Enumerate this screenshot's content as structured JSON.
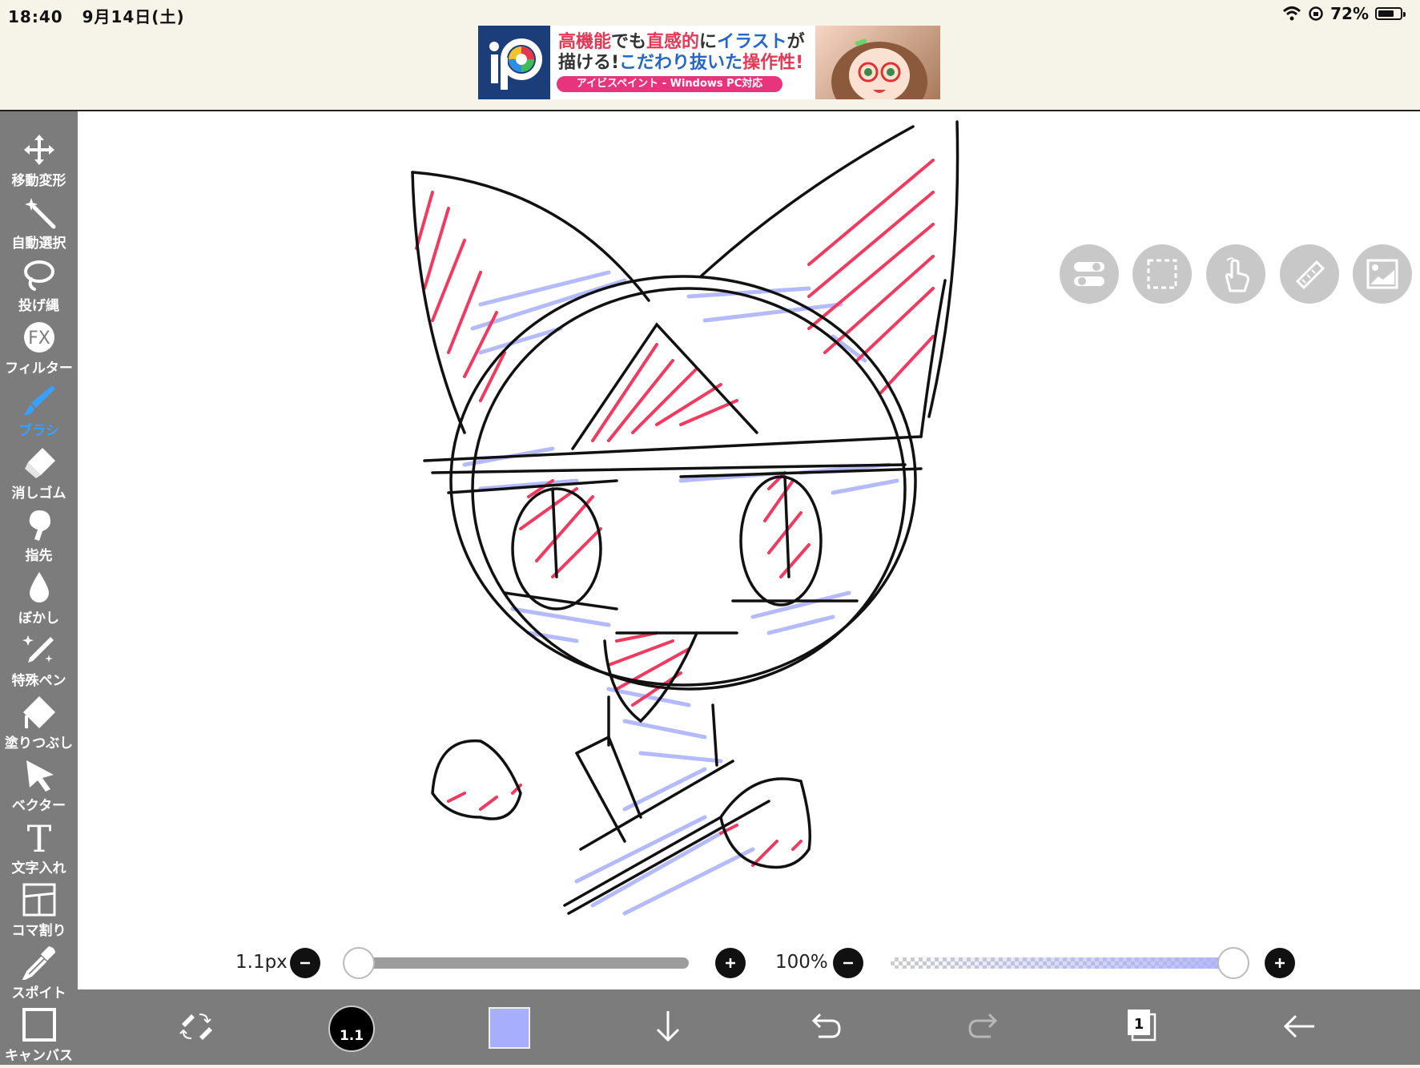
{
  "status": {
    "time": "18:40",
    "date": "9月14日(土)",
    "battery": "72%",
    "battery_level": 0.72
  },
  "ad": {
    "line1": {
      "a": "高機能",
      "b": "でも",
      "c": "直感的",
      "d": "に",
      "e": "イラスト",
      "f": "が"
    },
    "line2": {
      "a": "描ける!",
      "b": "こだわり抜いた",
      "c": "操作性!"
    },
    "strip": "アイビスペイント - Windows PC対応"
  },
  "tools": [
    {
      "label": "移動変形",
      "icon": "move-icon"
    },
    {
      "label": "自動選択",
      "icon": "magic-wand-icon"
    },
    {
      "label": "投げ縄",
      "icon": "lasso-icon"
    },
    {
      "label": "フィルター",
      "icon": "fx-icon",
      "icon_text": "FX"
    },
    {
      "label": "ブラシ",
      "icon": "brush-icon",
      "active": true
    },
    {
      "label": "消しゴム",
      "icon": "eraser-icon"
    },
    {
      "label": "指先",
      "icon": "finger-icon"
    },
    {
      "label": "ぼかし",
      "icon": "drop-icon"
    },
    {
      "label": "特殊ペン",
      "icon": "special-pen-icon"
    },
    {
      "label": "塗りつぶし",
      "icon": "fill-icon"
    },
    {
      "label": "ベクター",
      "icon": "vector-icon"
    },
    {
      "label": "文字入れ",
      "icon": "text-icon",
      "icon_text": "T"
    },
    {
      "label": "コマ割り",
      "icon": "frame-divider-icon"
    },
    {
      "label": "スポイト",
      "icon": "eyedropper-icon"
    },
    {
      "label": "キャンバス",
      "icon": "canvas-icon"
    }
  ],
  "sliders": {
    "size_label": "1.1px",
    "size_level": 0.0,
    "opacity_label": "100%",
    "opacity_level": 1.0
  },
  "bottom": {
    "brush_size": "1.1",
    "color": "#a7aefc",
    "layer_count": "1"
  },
  "colors": {
    "toolbar": "#7c7c7c",
    "active": "#3aa0ff",
    "ink_red": "#f03a5f",
    "ink_blue": "#a7aefc"
  }
}
